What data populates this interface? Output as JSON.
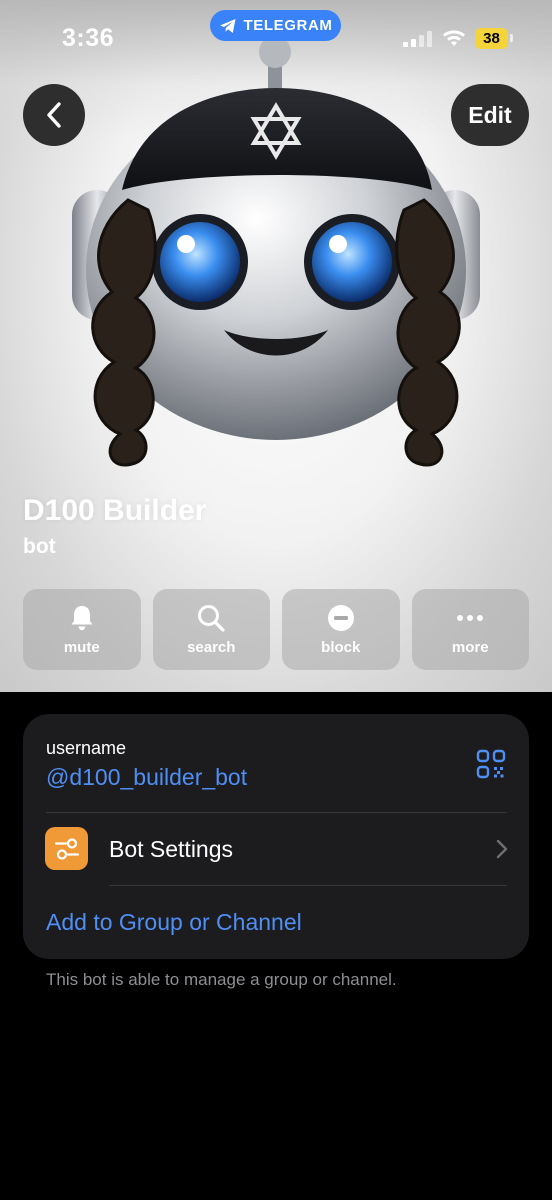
{
  "status_bar": {
    "time": "3:36",
    "app_pill": "TELEGRAM",
    "battery": "38"
  },
  "nav": {
    "edit_label": "Edit"
  },
  "profile": {
    "name": "D100 Builder",
    "subtitle": "bot"
  },
  "actions": [
    {
      "label": "mute",
      "icon": "bell-icon"
    },
    {
      "label": "search",
      "icon": "search-icon"
    },
    {
      "label": "block",
      "icon": "block-icon"
    },
    {
      "label": "more",
      "icon": "more-icon"
    }
  ],
  "info": {
    "username_label": "username",
    "username_value": "@d100_builder_bot",
    "settings_label": "Bot Settings",
    "add_label": "Add to Group or Channel"
  },
  "footer_note": "This bot is able to manage a group or channel.",
  "colors": {
    "accent": "#4f8ff5",
    "pill": "#3a82f7",
    "card": "#1c1c1e",
    "settings_icon_bg": "#f09a37",
    "battery": "#f5d33a"
  }
}
